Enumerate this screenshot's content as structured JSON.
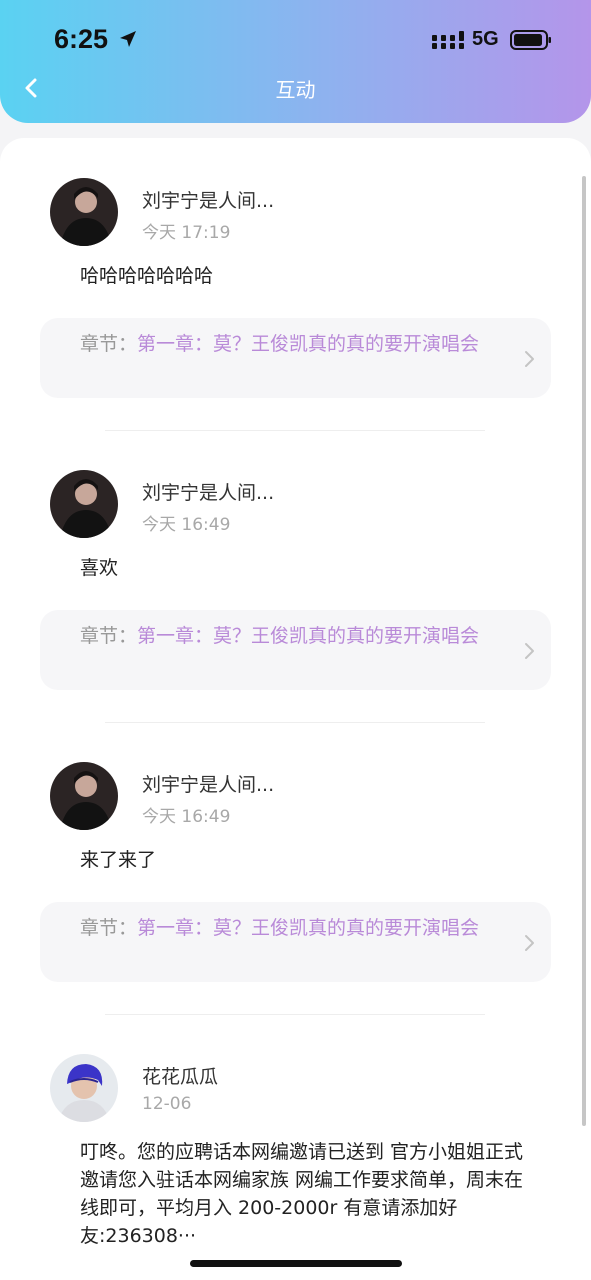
{
  "status_bar": {
    "time": "6:25",
    "network": "5G"
  },
  "header": {
    "title": "互动"
  },
  "comments": [
    {
      "username": "刘宇宁是人间...",
      "time": "今天 17:19",
      "content": "哈哈哈哈哈哈哈",
      "chapter_label": "章节：",
      "chapter_title": "第一章：莫？王俊凯真的真的要开演唱会"
    },
    {
      "username": "刘宇宁是人间...",
      "time": "今天 16:49",
      "content": "喜欢",
      "chapter_label": "章节：",
      "chapter_title": "第一章：莫？王俊凯真的真的要开演唱会"
    },
    {
      "username": "刘宇宁是人间...",
      "time": "今天 16:49",
      "content": "来了来了",
      "chapter_label": "章节：",
      "chapter_title": "第一章：莫？王俊凯真的真的要开演唱会"
    },
    {
      "username": "花花瓜瓜",
      "time": "12-06",
      "content": "叮咚。您的应聘话本网编邀请已送到 官方小姐姐正式邀请您入驻话本网编家族 网编工作要求简单，周末在线即可，平均月入 200-2000r 有意请添加好友:236308···"
    }
  ],
  "colors": {
    "header_gradient": [
      "#5ad2f2",
      "#b495ea"
    ],
    "chapter_title": "#b98ad8",
    "timestamp": "#a8a8a8"
  }
}
